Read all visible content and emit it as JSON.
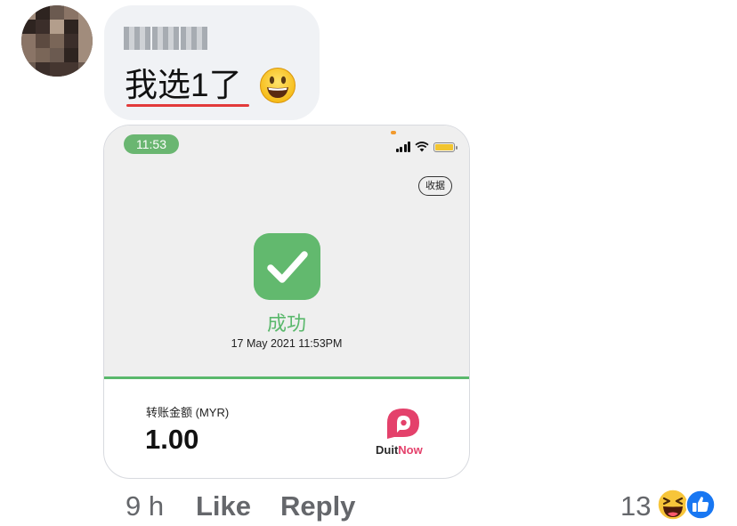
{
  "comment": {
    "text": "我选1了",
    "emoji_icon": "grinning-face-emoji",
    "attachment": {
      "status_time": "11:53",
      "receipt_button": "收据",
      "status": "成功",
      "datetime": "17 May 2021 11:53PM",
      "amount_label": "转账金额 (MYR)",
      "amount": "1.00",
      "brand_part1": "Duit",
      "brand_part2": "Now",
      "brand_color": "#e4416b",
      "success_color": "#62b96e"
    }
  },
  "meta": {
    "time_ago": "9 h",
    "like_label": "Like",
    "reply_label": "Reply",
    "reaction_count": "13",
    "reaction_icons": [
      "haha-emoji-icon",
      "like-reaction-icon"
    ]
  }
}
